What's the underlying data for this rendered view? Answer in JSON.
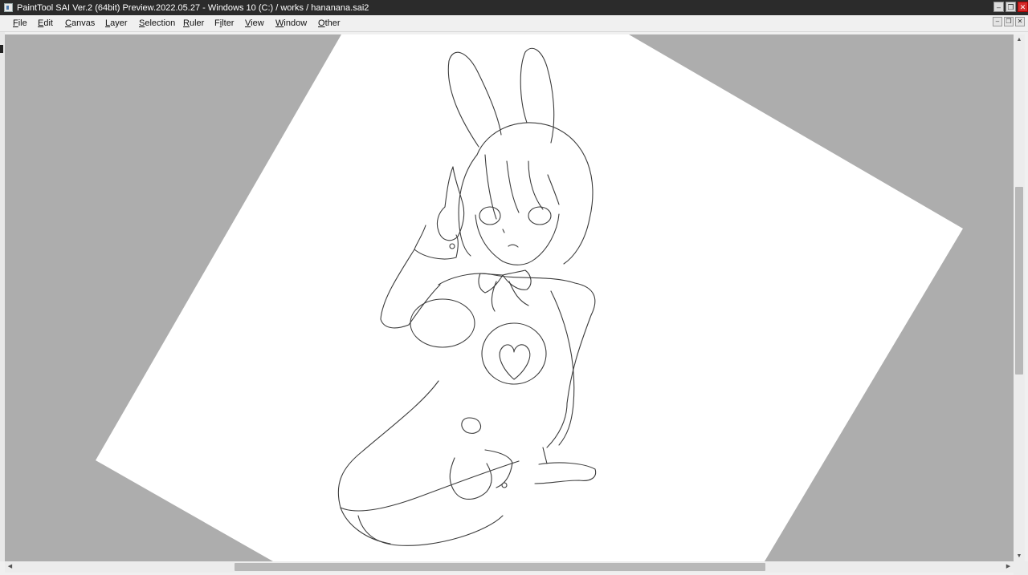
{
  "window": {
    "title": "PaintTool SAI Ver.2 (64bit) Preview.2022.05.27 - Windows 10 (C:) / works / hananana.sai2",
    "icon": "app-icon",
    "controls": {
      "minimize": "–",
      "restore": "❐",
      "close": "✕"
    }
  },
  "menubar": {
    "items": [
      {
        "label": "File",
        "accel": "F"
      },
      {
        "label": "Edit",
        "accel": "E"
      },
      {
        "label": "Canvas",
        "accel": "C"
      },
      {
        "label": "Layer",
        "accel": "L"
      },
      {
        "label": "Selection",
        "accel": "S"
      },
      {
        "label": "Ruler",
        "accel": "R"
      },
      {
        "label": "Filter",
        "accel": "i"
      },
      {
        "label": "View",
        "accel": "V"
      },
      {
        "label": "Window",
        "accel": "W"
      },
      {
        "label": "Other",
        "accel": "O"
      }
    ],
    "mdi_controls": {
      "minimize": "–",
      "restore": "❐",
      "close": "✕"
    }
  },
  "canvas": {
    "background_color": "#adadad",
    "paper_color": "#ffffff",
    "content": "line-art sketch of a bunny-eared character",
    "line_color": "#3a3a3a"
  },
  "scrollbars": {
    "vertical": {
      "up": "▲",
      "down": "▼",
      "position": 0.29
    },
    "horizontal": {
      "left": "◀",
      "right": "▶",
      "position": 0.23
    }
  }
}
